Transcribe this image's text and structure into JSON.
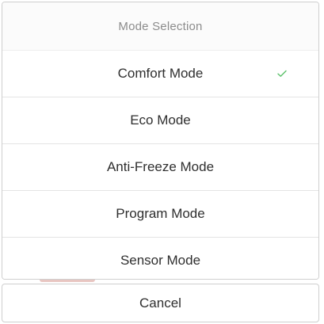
{
  "sheet": {
    "title": "Mode Selection",
    "options": [
      {
        "label": "Comfort Mode",
        "selected": true
      },
      {
        "label": "Eco Mode",
        "selected": false
      },
      {
        "label": "Anti-Freeze Mode",
        "selected": false
      },
      {
        "label": "Program Mode",
        "selected": false
      },
      {
        "label": "Sensor Mode",
        "selected": false
      }
    ],
    "check_icon": "checkmark-icon",
    "check_color": "#5cc16b"
  },
  "cancel": {
    "label": "Cancel"
  }
}
